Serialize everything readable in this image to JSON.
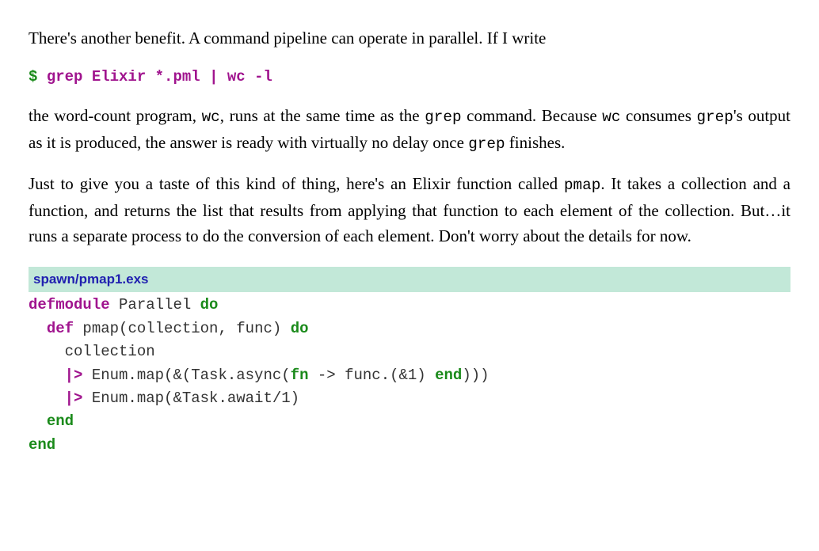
{
  "para1": {
    "text": "There's another benefit. A command pipeline can operate in parallel. If I write"
  },
  "shell": {
    "prompt": "$",
    "t1": "grep",
    "t2": "Elixir",
    "t3": "*.pml",
    "t4": "|",
    "t5": "wc",
    "t6": "-l"
  },
  "para2": {
    "a": "the word-count program, ",
    "b": "wc",
    "c": ", runs at the same time as the ",
    "d": "grep",
    "e": " command. Because ",
    "f": "wc",
    "g": " consumes ",
    "h": "grep",
    "i": "'s output as it is produced, the answer is ready with virtually no delay once ",
    "j": "grep",
    "k": " finishes."
  },
  "para3": {
    "a": "Just to give you a taste of this kind of thing, here's an Elixir function called ",
    "b": "pmap",
    "c": ". It takes a collection and a function, and returns the list that results from applying that function to each element of the collection. But…it runs a separate process to do the conversion of each element. Don't worry about the details for now."
  },
  "codefile": "spawn/pmap1.exs",
  "code": {
    "l1": {
      "a": "defmodule",
      "b": " Parallel ",
      "c": "do"
    },
    "l2": {
      "a": "  ",
      "b": "def",
      "c": " pmap(collection, func) ",
      "d": "do"
    },
    "l3": {
      "a": "    collection"
    },
    "l4": {
      "a": "    ",
      "b": "|>",
      "c": " Enum.map(&(Task.async(",
      "d": "fn",
      "e": " -> func.(&1) ",
      "f": "end",
      "g": ")))"
    },
    "l5": {
      "a": "    ",
      "b": "|>",
      "c": " Enum.map(&Task.await/1)"
    },
    "l6": {
      "a": "  ",
      "b": "end"
    },
    "l7": {
      "a": "end"
    }
  }
}
